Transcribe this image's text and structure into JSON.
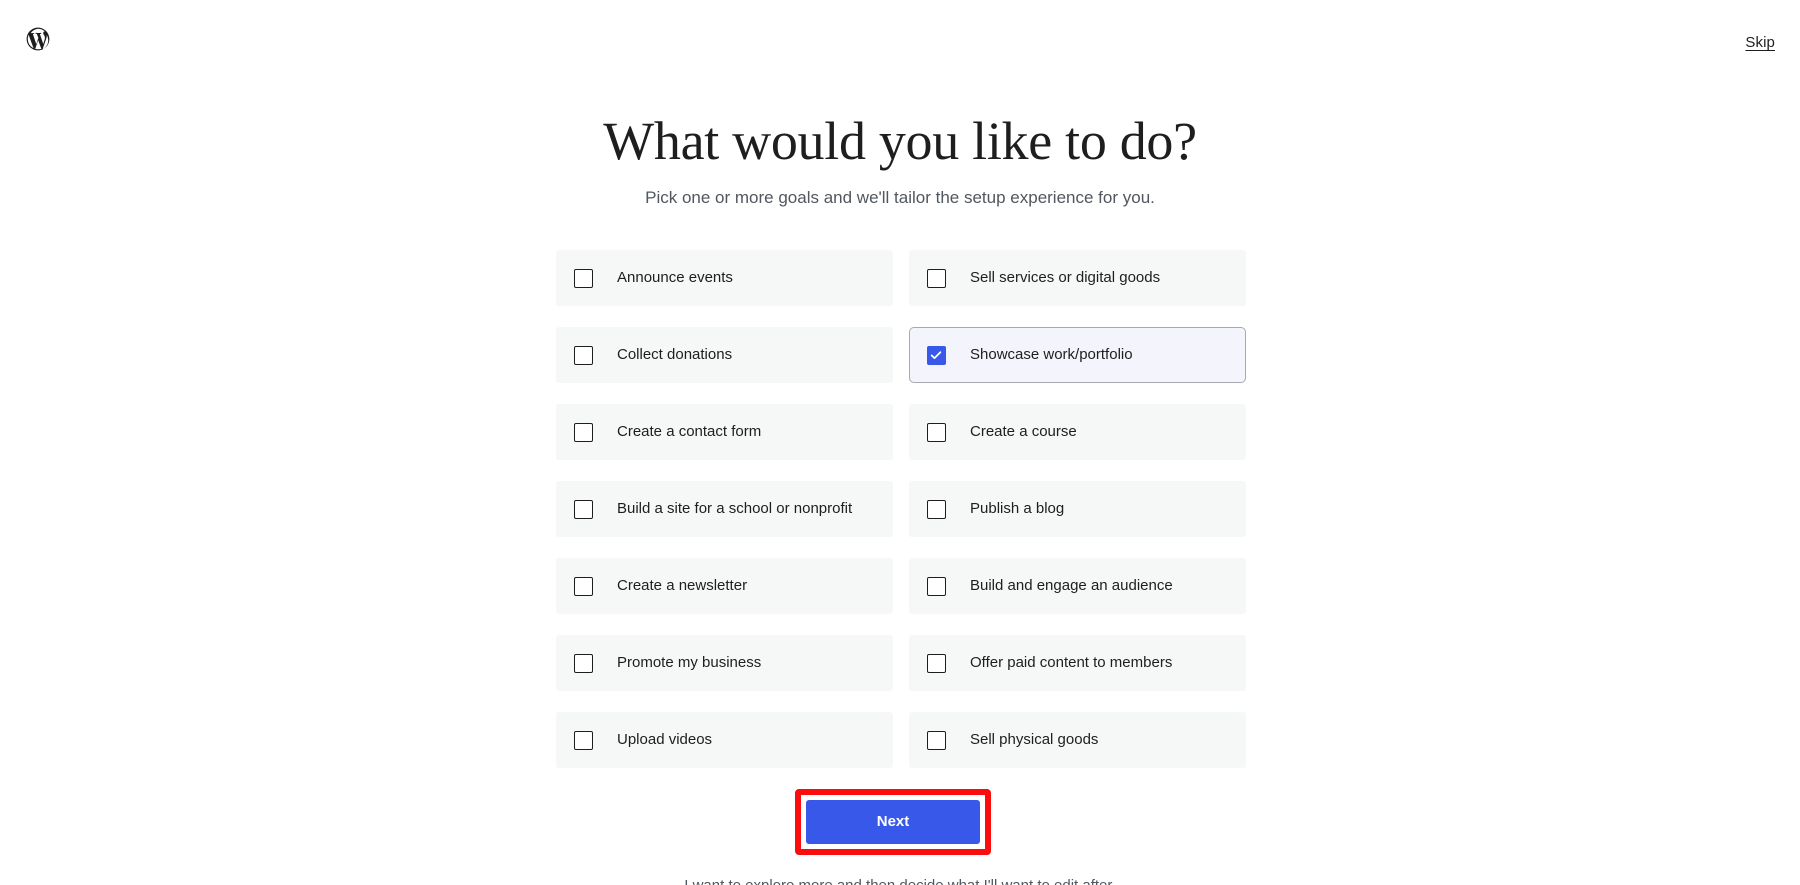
{
  "header": {
    "logo_icon": "wordpress-logo-icon",
    "skip_label": "Skip"
  },
  "main": {
    "title": "What would you like to do?",
    "subtitle": "Pick one or more goals and we'll tailor the setup experience for you.",
    "goals": [
      {
        "label": "Announce events",
        "checked": false
      },
      {
        "label": "Sell services or digital goods",
        "checked": false
      },
      {
        "label": "Collect donations",
        "checked": false
      },
      {
        "label": "Showcase work/portfolio",
        "checked": true
      },
      {
        "label": "Create a contact form",
        "checked": false
      },
      {
        "label": "Create a course",
        "checked": false
      },
      {
        "label": "Build a site for a school or nonprofit",
        "checked": false
      },
      {
        "label": "Publish a blog",
        "checked": false
      },
      {
        "label": "Create a newsletter",
        "checked": false
      },
      {
        "label": "Build and engage an audience",
        "checked": false
      },
      {
        "label": "Promote my business",
        "checked": false
      },
      {
        "label": "Offer paid content to members",
        "checked": false
      },
      {
        "label": "Upload videos",
        "checked": false
      },
      {
        "label": "Sell physical goods",
        "checked": false
      }
    ],
    "next_label": "Next",
    "bottom_note": "I want to explore more and then decide what I'll want to edit after."
  },
  "colors": {
    "accent_blue": "#3858e9",
    "annotation_red": "#fc0d0d",
    "card_bg": "#f6f7f7",
    "card_selected_bg": "#f4f5fc",
    "card_selected_border": "#a7aaad",
    "text_primary": "#1e1e1e",
    "text_secondary": "#50575e"
  }
}
